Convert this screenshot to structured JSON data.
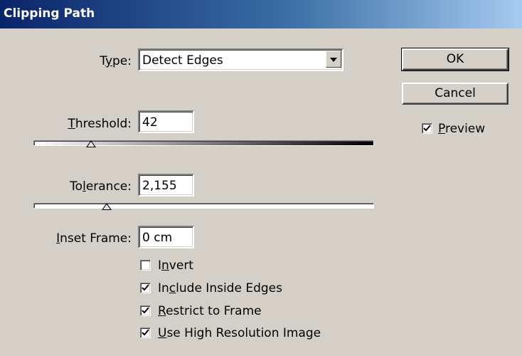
{
  "window": {
    "title": "Clipping Path"
  },
  "type": {
    "label_before": "T",
    "label_mnemonic": "y",
    "label_after": "pe:",
    "value": "Detect Edges"
  },
  "threshold": {
    "label_mnemonic": "T",
    "label_after": "hreshold:",
    "value": "42",
    "slider_fraction": 0.16
  },
  "tolerance": {
    "label_before": "To",
    "label_mnemonic": "l",
    "label_after": "erance:",
    "value": "2,155",
    "slider_fraction": 0.21
  },
  "inset_frame": {
    "label_mnemonic": "I",
    "label_after": "nset Frame:",
    "value": "0 cm"
  },
  "options": {
    "invert": {
      "before": "I",
      "mnemonic": "n",
      "after": "vert",
      "checked": false
    },
    "include_inside_edges": {
      "before": "In",
      "mnemonic": "c",
      "after": "lude Inside Edges",
      "checked": true
    },
    "restrict_to_frame": {
      "before": "",
      "mnemonic": "R",
      "after": "estrict to Frame",
      "checked": true
    },
    "use_high_resolution": {
      "before": "",
      "mnemonic": "U",
      "after": "se High Resolution Image",
      "checked": true
    }
  },
  "buttons": {
    "ok": "OK",
    "cancel": "Cancel"
  },
  "preview": {
    "before": "",
    "mnemonic": "P",
    "after": "review",
    "checked": true
  },
  "colors": {
    "titlebar_start": "#0a246a",
    "titlebar_end": "#a6caf0",
    "dialog_bg": "#d4d0c8"
  },
  "icons": {
    "dropdown": "chevron-down-icon",
    "check": "checkmark-icon",
    "slider_thumb": "triangle-thumb-icon"
  }
}
